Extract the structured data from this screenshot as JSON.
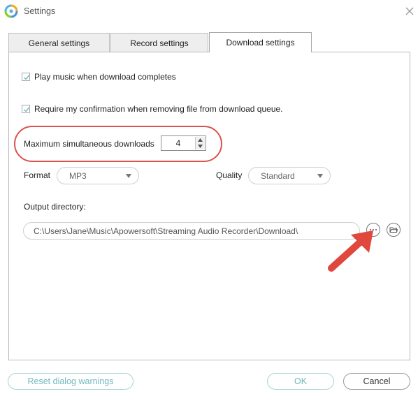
{
  "window": {
    "title": "Settings"
  },
  "tabs": [
    {
      "label": "General settings",
      "active": false
    },
    {
      "label": "Record settings",
      "active": false
    },
    {
      "label": "Download settings",
      "active": true
    }
  ],
  "download": {
    "play_music": {
      "label": "Play music when download completes",
      "checked": true
    },
    "require_confirmation": {
      "label": "Require my confirmation when removing file from download queue.",
      "checked": true
    },
    "max_downloads": {
      "label": "Maximum simultaneous downloads",
      "value": "4"
    },
    "format": {
      "label": "Format",
      "value": "MP3"
    },
    "quality": {
      "label": "Quality",
      "value": "Standard"
    },
    "output_directory": {
      "label": "Output directory:",
      "path": "C:\\Users\\Jane\\Music\\Apowersoft\\Streaming Audio Recorder\\Download\\"
    }
  },
  "footer": {
    "reset_label": "Reset dialog warnings",
    "ok_label": "OK",
    "cancel_label": "Cancel"
  },
  "colors": {
    "accent": "#6fb9bd",
    "highlight": "#d9534f",
    "arrow": "#e0483e"
  }
}
